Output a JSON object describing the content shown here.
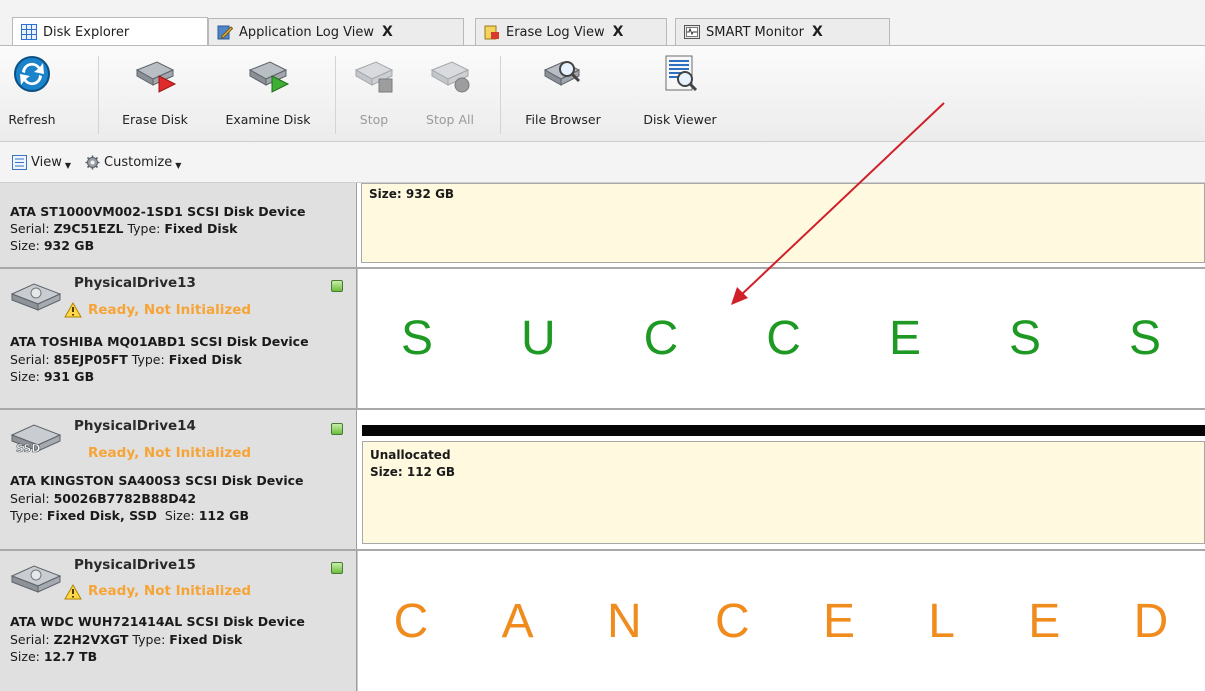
{
  "tabs": [
    {
      "label": "Disk Explorer",
      "active": true,
      "closable": false,
      "icon": "grid-icon"
    },
    {
      "label": "Application Log View",
      "active": false,
      "closable": true,
      "close": "X",
      "icon": "log-pencil-icon"
    },
    {
      "label": "Erase Log View",
      "active": false,
      "closable": true,
      "close": "X",
      "icon": "erase-log-icon"
    },
    {
      "label": "SMART Monitor",
      "active": false,
      "closable": true,
      "close": "X",
      "icon": "monitor-icon"
    }
  ],
  "toolbar": {
    "refresh": "Refresh",
    "erase_disk": "Erase Disk",
    "examine_disk": "Examine Disk",
    "stop": "Stop",
    "stop_all": "Stop All",
    "file_browser": "File Browser",
    "disk_viewer": "Disk Viewer"
  },
  "viewbar": {
    "view": "View",
    "customize": "Customize"
  },
  "disks": [
    {
      "model": "ATA ST1000VM002-1SD1 SCSI Disk Device",
      "serial_label": "Serial:",
      "serial": "Z9C51EZL",
      "type_label": "Type:",
      "type": "Fixed Disk",
      "size_label": "Size:",
      "size": "932 GB",
      "partition_size": "Size: 932 GB"
    },
    {
      "name": "PhysicalDrive13",
      "status": "Ready, Not Initialized",
      "model": "ATA TOSHIBA MQ01ABD1 SCSI Disk Device",
      "serial_label": "Serial:",
      "serial": "85EJP05FT",
      "type_label": "Type:",
      "type": "Fixed Disk",
      "size_label": "Size:",
      "size": "931 GB",
      "result": "SUCCESS",
      "result_color": "#1e9a24"
    },
    {
      "name": "PhysicalDrive14",
      "status": "Ready, Not Initialized",
      "model": "ATA KINGSTON SA400S3 SCSI Disk Device",
      "serial_label": "Serial:",
      "serial": "50026B7782B88D42",
      "type_label": "Type:",
      "type": "Fixed Disk, SSD",
      "size_label": "Size:",
      "size": "112 GB",
      "partition_label": "Unallocated",
      "partition_size": "Size: 112 GB",
      "icon_badge": "SSD"
    },
    {
      "name": "PhysicalDrive15",
      "status": "Ready, Not Initialized",
      "model": "ATA WDC WUH721414AL SCSI Disk Device",
      "serial_label": "Serial:",
      "serial": "Z2H2VXGT",
      "type_label": "Type:",
      "type": "Fixed Disk",
      "size_label": "Size:",
      "size": "12.7 TB",
      "result": "CANCELED",
      "result_color": "#f08c1e"
    }
  ],
  "colors": {
    "accent_arrow": "#d0202a",
    "warning": "#f7a437",
    "partition_bg": "#fffadf"
  }
}
